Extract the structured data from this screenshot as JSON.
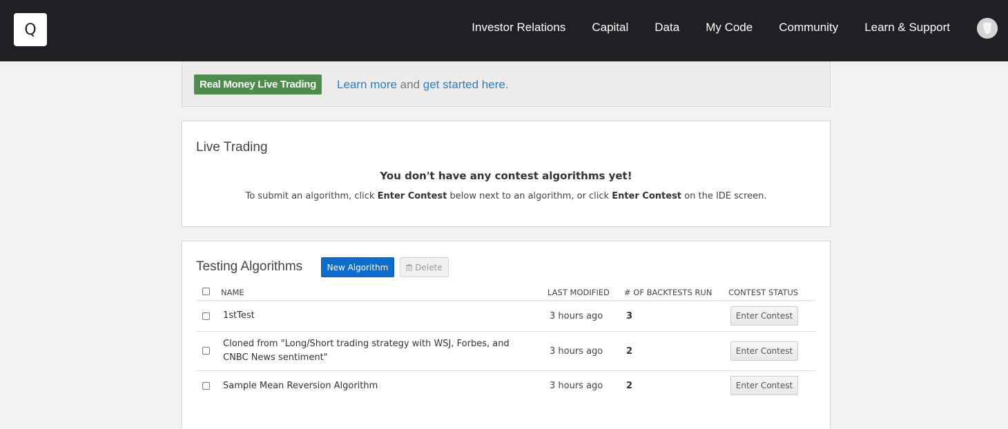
{
  "nav": {
    "logo": "Q",
    "items": [
      {
        "label": "Investor Relations"
      },
      {
        "label": "Capital"
      },
      {
        "label": "Data"
      },
      {
        "label": "My Code"
      },
      {
        "label": "Community"
      },
      {
        "label": "Learn & Support"
      }
    ]
  },
  "banner": {
    "badge": "Real Money Live Trading",
    "learn_more": "Learn more",
    "and": " and ",
    "get_started": "get started here",
    "period": "."
  },
  "live_trading": {
    "title": "Live Trading",
    "empty_heading": "You don't have any contest algorithms yet!",
    "empty_sub_1": "To submit an algorithm, click ",
    "enter_contest_1": "Enter Contest",
    "empty_sub_2": " below next to an algorithm, or click ",
    "enter_contest_2": "Enter Contest",
    "empty_sub_3": " on the IDE screen."
  },
  "testing": {
    "title": "Testing Algorithms",
    "new_button": "New Algorithm",
    "delete_button": "Delete",
    "columns": {
      "name": "NAME",
      "last_modified": "LAST MODIFIED",
      "backtests": "# OF BACKTESTS RUN",
      "contest_status": "CONTEST STATUS"
    },
    "rows": [
      {
        "name": "1stTest",
        "last_modified": "3 hours ago",
        "backtests": "3",
        "action": "Enter Contest"
      },
      {
        "name": "Cloned from \"Long/Short trading strategy with WSJ, Forbes, and CNBC News sentiment\"",
        "last_modified": "3 hours ago",
        "backtests": "2",
        "action": "Enter Contest"
      },
      {
        "name": "Sample Mean Reversion Algorithm",
        "last_modified": "3 hours ago",
        "backtests": "2",
        "action": "Enter Contest"
      }
    ]
  },
  "colors": {
    "topbar": "#1f2023",
    "badge_green": "#4d8c4d",
    "link_blue": "#2a7fc4",
    "primary_button": "#0d6ccc"
  }
}
